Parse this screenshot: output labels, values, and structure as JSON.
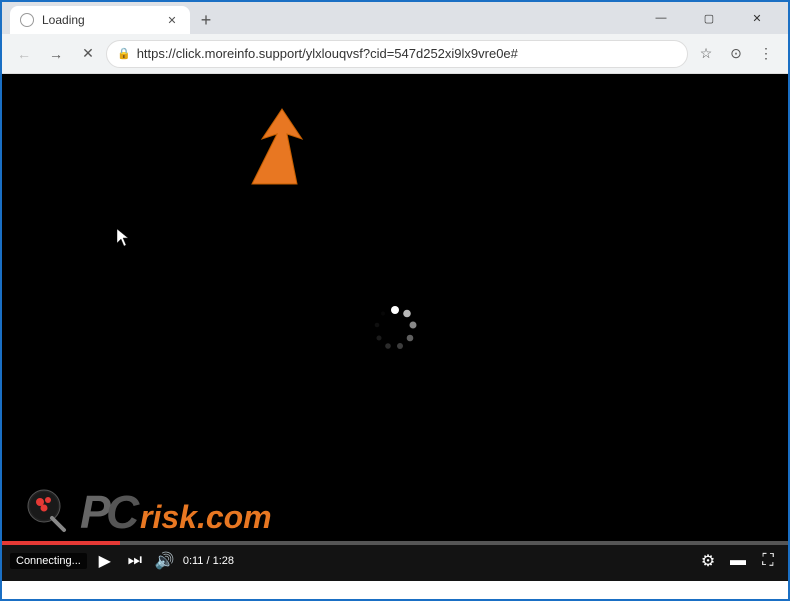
{
  "titlebar": {
    "tab_title": "Loading",
    "new_tab_label": "+",
    "minimize_label": "—",
    "maximize_label": "▢",
    "close_label": "✕"
  },
  "navbar": {
    "back_label": "←",
    "forward_label": "→",
    "reload_label": "✕",
    "url": "https://click.moreinfo.support/ylxlouqvsf?cid=547d252xi9lx9vre0e#",
    "bookmark_label": "☆",
    "account_label": "⊙",
    "menu_label": "⋮"
  },
  "video": {
    "connecting_text": "Connecting...",
    "time_current": "0:11",
    "time_total": "1:28",
    "time_display": "0:11 / 1:28"
  },
  "logo": {
    "text": "risk.com"
  }
}
